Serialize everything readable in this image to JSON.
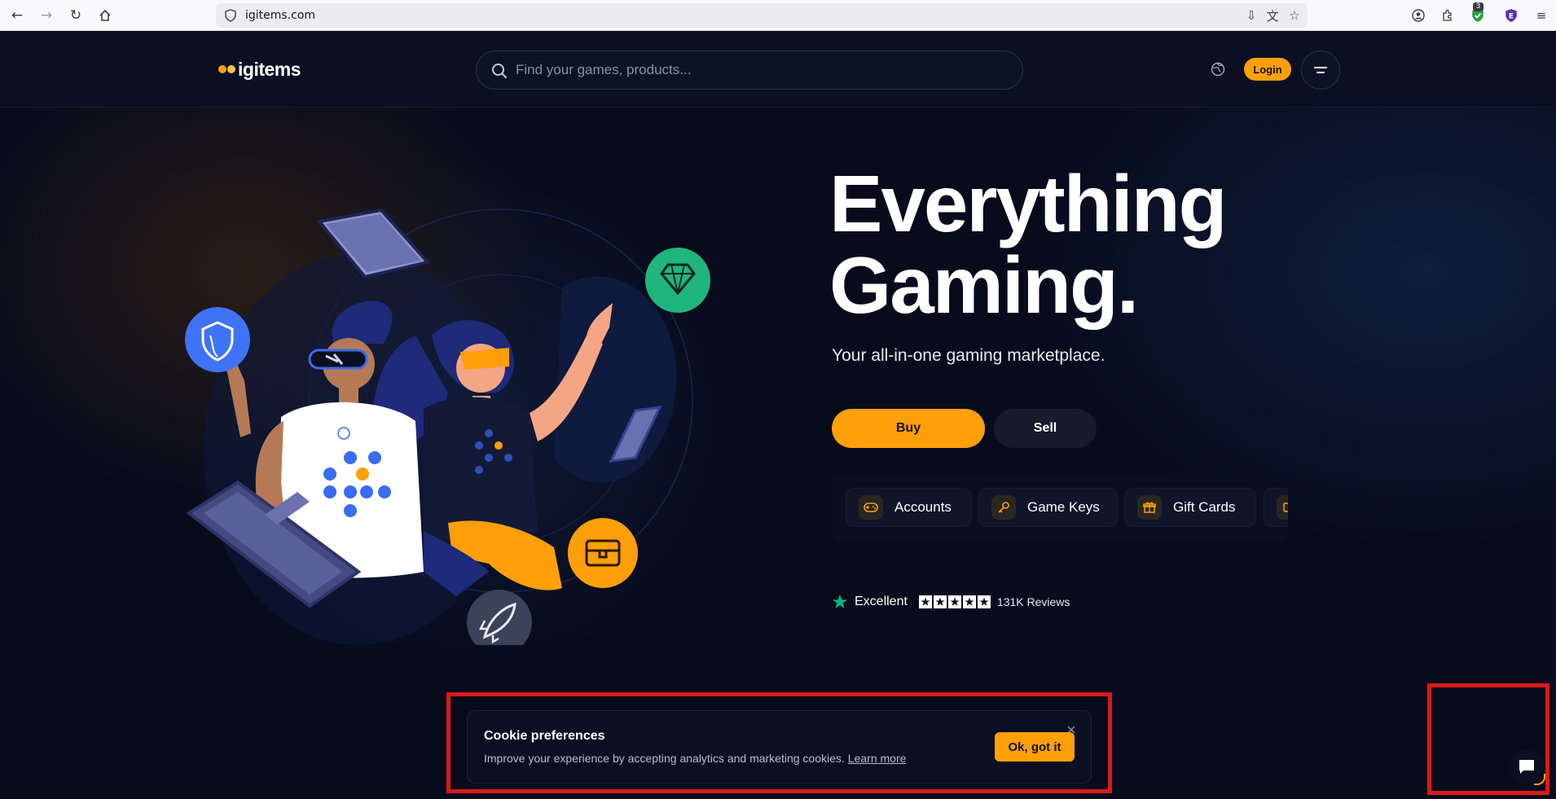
{
  "browser": {
    "url": "igitems.com",
    "extension_badge": "3"
  },
  "header": {
    "logo_text": "igitems",
    "logo_dot_colors": [
      "#ff9f0a",
      "#ffc53d"
    ],
    "search_placeholder": "Find your games, products...",
    "login_label": "Login"
  },
  "hero": {
    "headline_line1": "Everything",
    "headline_line2": "Gaming.",
    "subtitle": "Your all-in-one gaming marketplace.",
    "buy_label": "Buy",
    "sell_label": "Sell",
    "categories": [
      {
        "label": "Accounts",
        "icon": "gamepad-icon"
      },
      {
        "label": "Game Keys",
        "icon": "key-icon"
      },
      {
        "label": "Gift Cards",
        "icon": "gift-icon"
      },
      {
        "label": "",
        "icon": "card-icon"
      }
    ],
    "rating": {
      "label": "Excellent",
      "stars": 5,
      "reviews": "131K Reviews"
    }
  },
  "cookie": {
    "title": "Cookie preferences",
    "text": "Improve your experience by accepting analytics and marketing cookies.",
    "link": "Learn more",
    "ok_label": "Ok, got it"
  },
  "colors": {
    "accent": "#ff9f0a",
    "background": "#070b1c",
    "trustpilot_green": "#00b67a",
    "highlight_outline": "#d91a1a"
  }
}
